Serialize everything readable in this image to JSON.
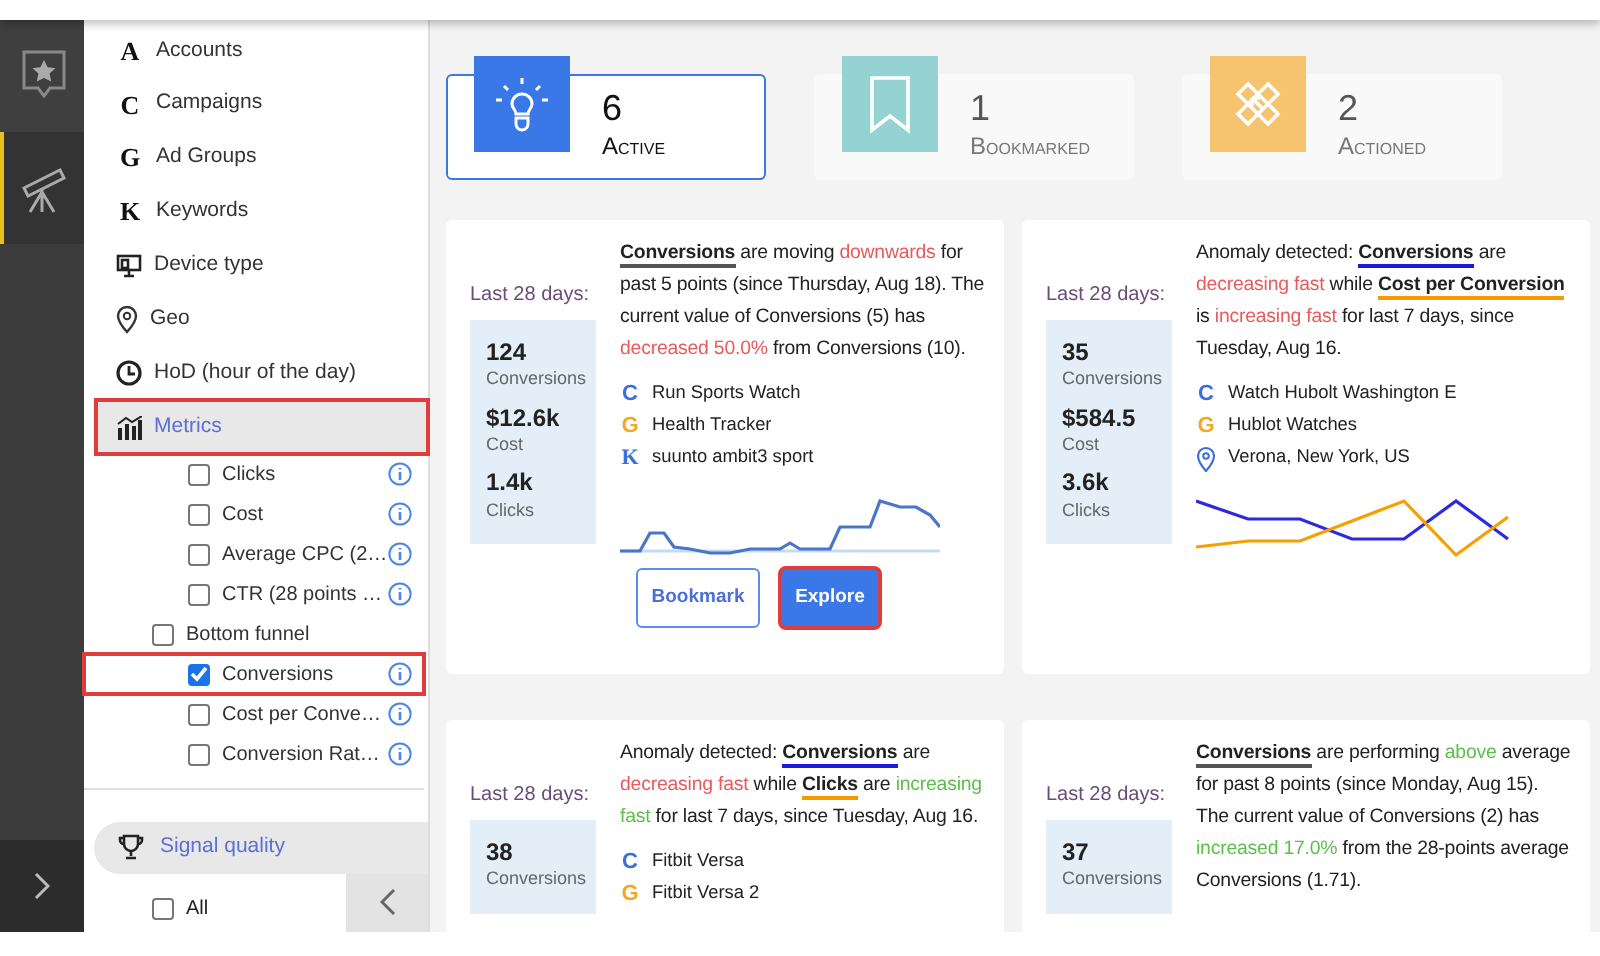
{
  "rail": {
    "items": [
      {
        "kind": "star",
        "selected": false
      },
      {
        "kind": "telescope",
        "selected": true
      }
    ]
  },
  "sidebar": {
    "items": [
      {
        "label": "Accounts",
        "kind": "letter",
        "glyph": "A",
        "selected": false,
        "highlighted": false
      },
      {
        "label": "Campaigns",
        "kind": "letter",
        "glyph": "C",
        "selected": false,
        "highlighted": false
      },
      {
        "label": "Ad Groups",
        "kind": "letter",
        "glyph": "G",
        "selected": false,
        "highlighted": false
      },
      {
        "label": "Keywords",
        "kind": "letter",
        "glyph": "K",
        "selected": false,
        "highlighted": false
      },
      {
        "label": "Device type",
        "kind": "device",
        "selected": false,
        "highlighted": false
      },
      {
        "label": "Geo",
        "kind": "geo",
        "selected": false,
        "highlighted": false
      },
      {
        "label": "HoD (hour of the day)",
        "kind": "clock",
        "selected": false,
        "highlighted": false
      },
      {
        "label": "Metrics",
        "kind": "metrics",
        "selected": true,
        "highlighted": true
      }
    ],
    "metrics": [
      {
        "label": "Clicks",
        "kind": "metric",
        "checked": false,
        "highlighted": false
      },
      {
        "label": "Cost",
        "kind": "metric",
        "checked": false,
        "highlighted": false
      },
      {
        "label": "Average CPC (2…",
        "kind": "metric",
        "checked": false,
        "highlighted": false
      },
      {
        "label": "CTR (28 points …",
        "kind": "metric",
        "checked": false,
        "highlighted": false
      },
      {
        "label": "Bottom funnel",
        "kind": "group",
        "checked": false,
        "highlighted": false
      },
      {
        "label": "Conversions",
        "kind": "metric",
        "checked": true,
        "highlighted": true
      },
      {
        "label": "Cost per Conve…",
        "kind": "metric",
        "checked": false,
        "highlighted": false
      },
      {
        "label": "Conversion Rat…",
        "kind": "metric",
        "checked": false,
        "highlighted": false
      }
    ],
    "signal": {
      "label": "Signal quality"
    },
    "all": {
      "label": "All",
      "checked": false
    }
  },
  "stats": [
    {
      "count": "6",
      "label": "Active",
      "kind": "bulb",
      "color": "#3b78e7",
      "selected": true
    },
    {
      "count": "1",
      "label": "Bookmarked",
      "kind": "bookmark",
      "color": "#95d3d3",
      "selected": false
    },
    {
      "count": "2",
      "label": "Actioned",
      "kind": "arrows",
      "color": "#f6c36e",
      "selected": false
    }
  ],
  "cards": [
    {
      "period": "Last 28 days:",
      "metrics": [
        {
          "value": "124",
          "label": "Conversions"
        },
        {
          "value": "$12.6k",
          "label": "Cost"
        },
        {
          "value": "1.4k",
          "label": "Clicks"
        }
      ],
      "text": [
        {
          "kind": "metric",
          "text": "Conversions",
          "color": "#555555"
        },
        {
          "kind": "plain",
          "text": " are moving "
        },
        {
          "kind": "down",
          "text": "downwards"
        },
        {
          "kind": "plain",
          "text": " for past 5 points (since Thursday, Aug 18). The current value of Conversions (5) has "
        },
        {
          "kind": "down",
          "text": "decreased 50.0%"
        },
        {
          "kind": "plain",
          "text": " from Conversions (10)."
        }
      ],
      "entities": [
        {
          "kind": "letter",
          "glyph": "C",
          "color": "#3b6fe0",
          "text": "Run Sports Watch"
        },
        {
          "kind": "letter",
          "glyph": "G",
          "color": "#f5a623",
          "text": "Health Tracker"
        },
        {
          "kind": "letter",
          "glyph": "K",
          "color": "#3b6fe0",
          "text": "suunto ambit3 sport"
        }
      ],
      "chart": {
        "kind": "trend"
      },
      "buttons": [
        {
          "label": "Bookmark",
          "kind": "outline",
          "highlighted": false
        },
        {
          "label": "Explore",
          "kind": "primary",
          "highlighted": true
        }
      ]
    },
    {
      "period": "Last 28 days:",
      "metrics": [
        {
          "value": "35",
          "label": "Conversions"
        },
        {
          "value": "$584.5",
          "label": "Cost"
        },
        {
          "value": "3.6k",
          "label": "Clicks"
        }
      ],
      "text": [
        {
          "kind": "plain",
          "text": "Anomaly detected: "
        },
        {
          "kind": "metric",
          "text": "Conversions",
          "color": "#1a1adb"
        },
        {
          "kind": "plain",
          "text": " are "
        },
        {
          "kind": "down",
          "text": "decreasing fast"
        },
        {
          "kind": "plain",
          "text": " while "
        },
        {
          "kind": "metric",
          "text": "Cost per Conversion",
          "color": "#f59b00"
        },
        {
          "kind": "plain",
          "text": " is "
        },
        {
          "kind": "down",
          "text": "increasing fast"
        },
        {
          "kind": "plain",
          "text": " for last 7 days, since Tuesday, Aug 16."
        }
      ],
      "entities": [
        {
          "kind": "letter",
          "glyph": "C",
          "color": "#3b6fe0",
          "text": "Watch Hubolt Washington E"
        },
        {
          "kind": "letter",
          "glyph": "G",
          "color": "#f5a623",
          "text": "Hublot Watches"
        },
        {
          "kind": "geo",
          "color": "#3b6fe0",
          "text": "Verona, New York, US"
        }
      ],
      "chart": {
        "kind": "comparison"
      }
    },
    {
      "period": "Last 28 days:",
      "metrics": [
        {
          "value": "38",
          "label": "Conversions"
        }
      ],
      "text": [
        {
          "kind": "plain",
          "text": "Anomaly detected: "
        },
        {
          "kind": "metric",
          "text": "Conversions",
          "color": "#1a1adb"
        },
        {
          "kind": "plain",
          "text": " are "
        },
        {
          "kind": "down",
          "text": "decreasing fast"
        },
        {
          "kind": "plain",
          "text": " while "
        },
        {
          "kind": "metric",
          "text": "Clicks",
          "color": "#f59b00"
        },
        {
          "kind": "plain",
          "text": " are "
        },
        {
          "kind": "up",
          "text": "increasing fast"
        },
        {
          "kind": "plain",
          "text": " for last 7 days, since Tuesday, Aug 16."
        }
      ],
      "entities": [
        {
          "kind": "letter",
          "glyph": "C",
          "color": "#3b6fe0",
          "text": "Fitbit Versa"
        },
        {
          "kind": "letter",
          "glyph": "G",
          "color": "#f5a623",
          "text": "Fitbit Versa 2"
        }
      ]
    },
    {
      "period": "Last 28 days:",
      "metrics": [
        {
          "value": "37",
          "label": "Conversions"
        }
      ],
      "text": [
        {
          "kind": "metric",
          "text": "Conversions",
          "color": "#555555"
        },
        {
          "kind": "plain",
          "text": " are performing "
        },
        {
          "kind": "up",
          "text": "above"
        },
        {
          "kind": "plain",
          "text": " average for past 8 points (since Monday, Aug 15). The current value of Conversions (2) has "
        },
        {
          "kind": "up",
          "text": "increased 17.0%"
        },
        {
          "kind": "plain",
          "text": " from the 28-points average Conversions (1.71)."
        }
      ]
    }
  ]
}
